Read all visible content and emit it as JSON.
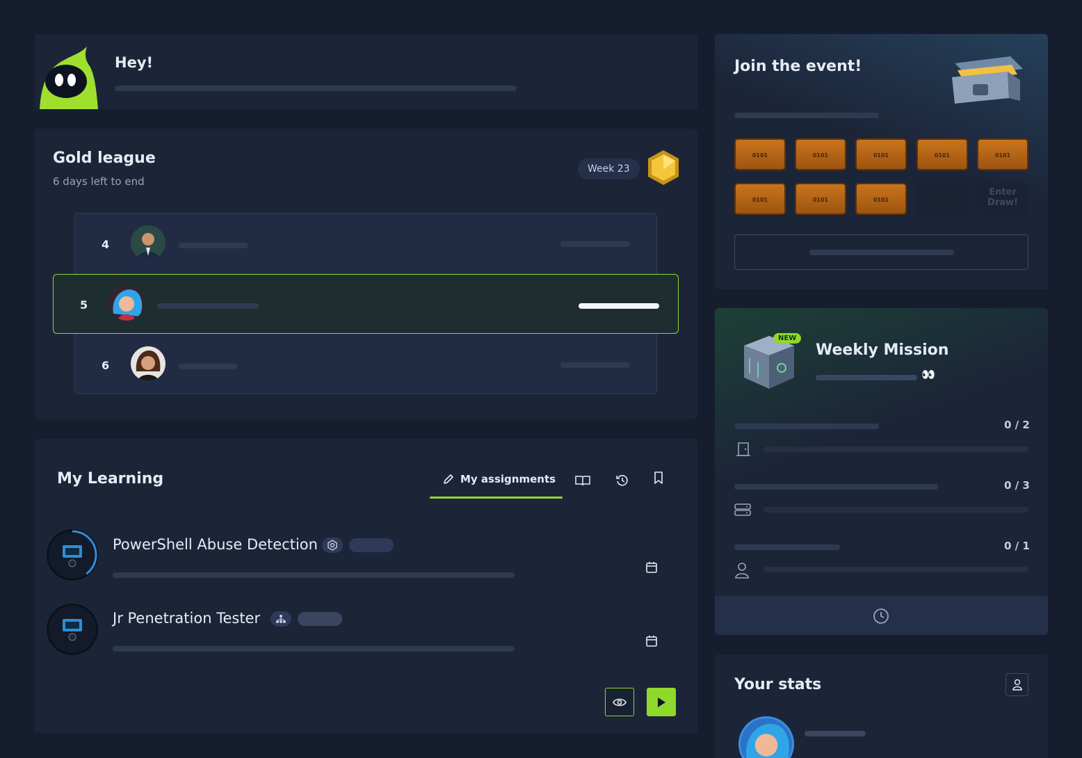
{
  "greeting": {
    "title": "Hey!"
  },
  "league": {
    "title": "Gold league",
    "subtitle": "6 days left to end",
    "week": "Week 23",
    "rows": [
      {
        "rank": "4"
      },
      {
        "rank": "5"
      },
      {
        "rank": "6"
      }
    ]
  },
  "learning": {
    "title": "My Learning",
    "tabs": {
      "assignments": "My assignments"
    },
    "courses": [
      {
        "title": "PowerShell Abuse Detection",
        "progress": 0.4
      },
      {
        "title": "Jr Penetration Tester",
        "progress": 0
      }
    ]
  },
  "event": {
    "title": "Join the event!",
    "ticket_label": "0101",
    "enter_label": "Enter Draw!"
  },
  "weekly": {
    "title": "Weekly Mission",
    "badge": "NEW",
    "emoji": "👀",
    "tasks": [
      {
        "count": "0 / 2"
      },
      {
        "count": "0 / 3"
      },
      {
        "count": "0 / 1"
      }
    ]
  },
  "stats": {
    "title": "Your stats"
  },
  "colors": {
    "accent": "#8fd82c",
    "bg": "#161d2e",
    "card": "#1c2538"
  }
}
